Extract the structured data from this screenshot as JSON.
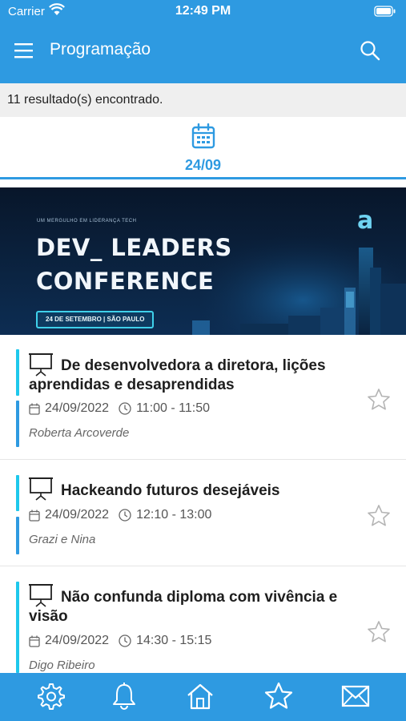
{
  "status_bar": {
    "carrier": "Carrier",
    "time": "12:49 PM"
  },
  "header": {
    "title": "Programação",
    "menu_icon": "hamburger-menu-icon",
    "search_icon": "search-icon"
  },
  "results": {
    "text": "11 resultado(s) encontrado."
  },
  "date_tab": {
    "icon": "calendar-icon",
    "label": "24/09"
  },
  "banner": {
    "tagline": "UM MERGULHO EM LIDERANÇA TECH",
    "title_line1": "DEV_ LEADERS",
    "title_line2": "CONFERENCE",
    "badge": "24 DE SETEMBRO | SÃO PAULO",
    "logo": "a"
  },
  "sessions": [
    {
      "title": "De desenvolvedora a diretora, lições aprendidas e desaprendidas",
      "date": "24/09/2022",
      "time": "11:00 - 11:50",
      "speaker": "Roberta Arcoverde",
      "favorite": false
    },
    {
      "title": "Hackeando futuros desejáveis",
      "date": "24/09/2022",
      "time": "12:10 - 13:00",
      "speaker": "Grazi e Nina",
      "favorite": false
    },
    {
      "title": "Não confunda diploma com vivência e visão",
      "date": "24/09/2022",
      "time": "14:30 - 15:15",
      "speaker": "Digo Ribeiro",
      "favorite": false
    }
  ],
  "tab_bar": {
    "items": [
      "settings-gear-icon",
      "notification-bell-icon",
      "home-icon",
      "favorites-star-icon",
      "mail-icon"
    ]
  },
  "colors": {
    "primary": "#2e9ae1",
    "accent_bar": "#1ec8ec",
    "results_bg": "#efefef"
  }
}
